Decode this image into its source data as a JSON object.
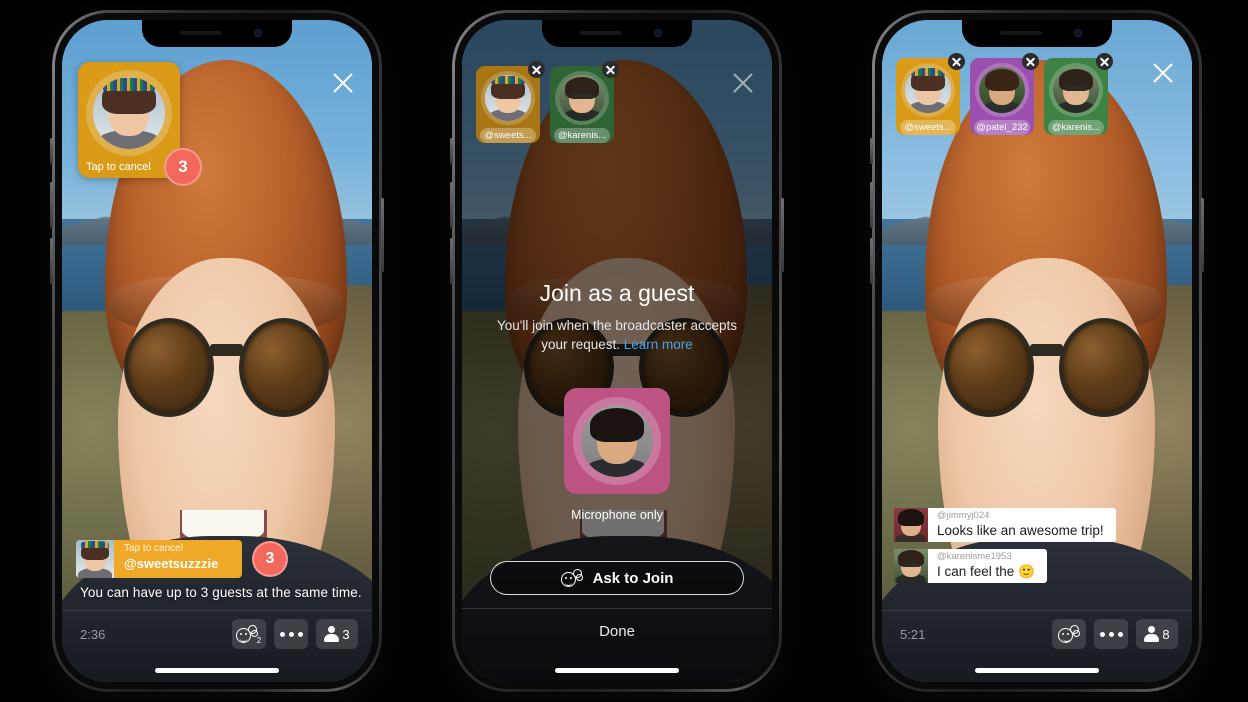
{
  "colors": {
    "guest_orange": "#d99a18",
    "pill_orange": "#f0a828",
    "badge_red": "#f2685c",
    "mic_pink": "#bd5383",
    "tile_purple": "#9b4faf",
    "tile_green": "#3e8244",
    "link_blue": "#4aa3e8"
  },
  "phone1": {
    "close_icon": "close-icon",
    "guest_card": {
      "caption": "Tap to cancel",
      "pending_count": "3",
      "avatar": "sweetsuzzzie-avatar"
    },
    "request_pill": {
      "line1": "Tap to cancel",
      "line2": "@sweetsuzzzie",
      "count": "3"
    },
    "hint": "You can have up to 3 guests at the same time.",
    "bottom_bar": {
      "timer": "2:36",
      "reactions_icon": "smiley-stack-icon",
      "reactions_count": "2",
      "more_icon": "more-dots-icon",
      "viewers_icon": "person-icon",
      "viewers_count": "3"
    }
  },
  "phone2": {
    "close_icon": "close-icon",
    "guests": [
      {
        "name": "@sweets...",
        "color": "#a87614",
        "avatar": "sweetsuzzzie-avatar",
        "close_icon": "remove-guest-icon"
      },
      {
        "name": "@karenis...",
        "color": "#2f6434",
        "avatar": "karenisme1953-avatar",
        "close_icon": "remove-guest-icon"
      }
    ],
    "modal": {
      "title": "Join as a guest",
      "subtitle": "You'll join when the broadcaster accepts your request.",
      "learn_more": "Learn more",
      "mic_label": "Microphone only",
      "mic_avatar": "jimmyj024-avatar",
      "ask_button": "Ask to Join",
      "ask_icon": "smiley-stack-icon",
      "done_button": "Done"
    }
  },
  "phone3": {
    "close_icon": "close-icon",
    "guests": [
      {
        "name": "@sweets...",
        "color": "#d99a18",
        "avatar": "sweetsuzzzie-avatar",
        "close_icon": "remove-guest-icon"
      },
      {
        "name": "@patel_232",
        "color": "#9b4faf",
        "avatar": "patel232-avatar",
        "close_icon": "remove-guest-icon"
      },
      {
        "name": "@karenis...",
        "color": "#3e8244",
        "avatar": "karenisme1953-avatar",
        "close_icon": "remove-guest-icon"
      }
    ],
    "chat": [
      {
        "user": "@jimmyj024",
        "message": "Looks like an awesome trip!",
        "avatar": "jimmyj024-avatar"
      },
      {
        "user": "@karenisme1953",
        "message": "I can feel the 🙂",
        "avatar": "karenisme1953-avatar"
      }
    ],
    "bottom_bar": {
      "timer": "5:21",
      "reactions_icon": "smiley-stack-icon",
      "more_icon": "more-dots-icon",
      "viewers_icon": "person-icon",
      "viewers_count": "8"
    }
  }
}
